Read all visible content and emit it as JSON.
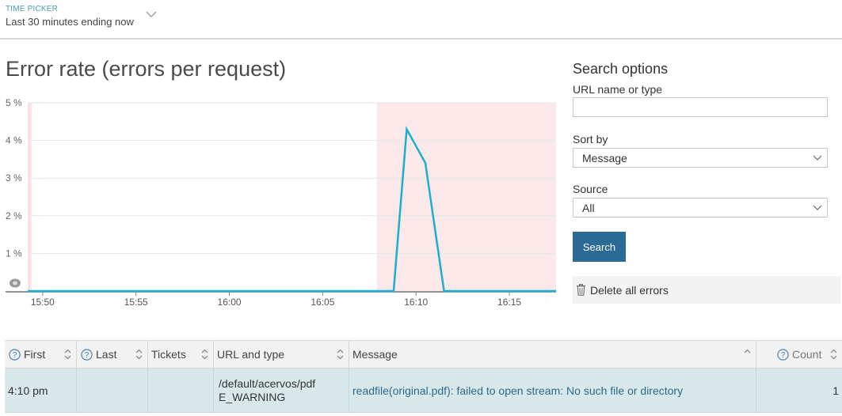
{
  "time_picker": {
    "label": "TIME PICKER",
    "value": "Last 30 minutes ending now"
  },
  "chart": {
    "title": "Error rate (errors per request)"
  },
  "chart_data": {
    "type": "line",
    "title": "Error rate (errors per request)",
    "ylabel": "",
    "xlabel": "",
    "y_ticks": [
      "5 %",
      "4 %",
      "3 %",
      "2 %",
      "1 %"
    ],
    "x_ticks": [
      "15:50",
      "15:55",
      "16:00",
      "16:05",
      "16:10",
      "16:15"
    ],
    "ylim": [
      0,
      5
    ],
    "xlim_minutes": [
      49.2,
      77.5
    ],
    "series": [
      {
        "color": "#1ab0cf",
        "x": [
          49.2,
          68.8,
          69.5,
          70.5,
          71.5,
          77.5
        ],
        "y": [
          0,
          0,
          4.3,
          3.4,
          0,
          0
        ]
      }
    ],
    "highlight_regions": [
      {
        "from": 49.2,
        "to": 49.4,
        "color": "#fbe1e1"
      },
      {
        "from": 67.9,
        "to": 77.5,
        "color": "#fbe8e8"
      }
    ],
    "grid": true
  },
  "search": {
    "title": "Search options",
    "url_label": "URL name or type",
    "url_value": "",
    "sort_label": "Sort by",
    "sort_value": "Message",
    "source_label": "Source",
    "source_value": "All",
    "search_button": "Search",
    "delete_label": "Delete all errors"
  },
  "table": {
    "headers": {
      "first": "First",
      "last": "Last",
      "tickets": "Tickets",
      "url": "URL and type",
      "message": "Message",
      "count": "Count"
    },
    "rows": [
      {
        "first": "4:10 pm",
        "last": "",
        "tickets": "",
        "url": "/default/acervos/pdf",
        "type": "E_WARNING",
        "message": "readfile(original.pdf): failed to open stream: No such file or directory",
        "count": "1"
      }
    ]
  },
  "colors": {
    "accent": "#2b6a94",
    "line": "#1ab0cf",
    "row_bg": "#d9e8ea",
    "alert_region": "#fbe8e8"
  }
}
